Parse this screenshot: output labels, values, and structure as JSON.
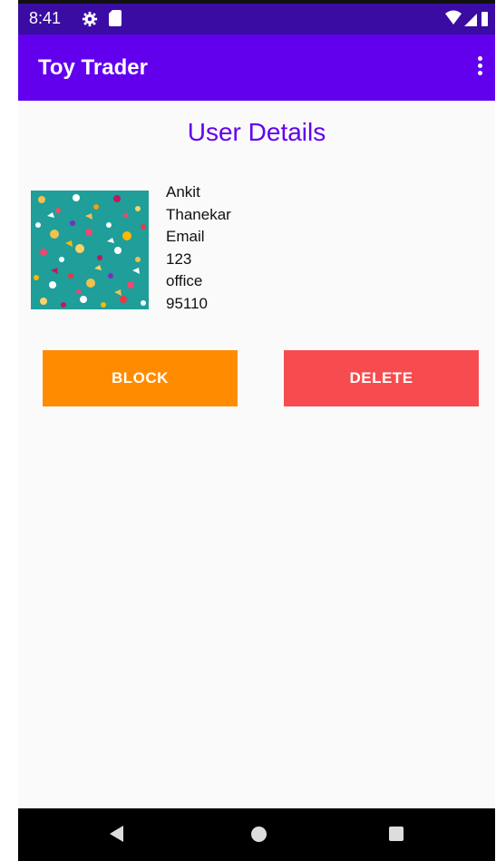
{
  "status_bar": {
    "time": "8:41",
    "icons": [
      "gear-icon",
      "sd-card-icon",
      "wifi-icon",
      "signal-icon",
      "battery-icon"
    ]
  },
  "app_bar": {
    "title": "Toy Trader",
    "overflow_icon": "more-vert-icon"
  },
  "page": {
    "heading": "User Details"
  },
  "user": {
    "avatar_icon": "patterned-toy-image",
    "first_name": "Ankit",
    "last_name": "Thanekar",
    "email": "Email",
    "phone": "123",
    "address": "office",
    "zip": "95110"
  },
  "actions": {
    "block_label": "BLOCK",
    "delete_label": "DELETE"
  },
  "colors": {
    "status_bar": "#3a0ca3",
    "app_bar": "#6200ee",
    "heading": "#6200ee",
    "block_button": "#ff8c00",
    "delete_button": "#f74c4f",
    "background": "#fafafa"
  },
  "nav_bar": {
    "icons": [
      "back-icon",
      "home-icon",
      "recents-icon"
    ]
  }
}
